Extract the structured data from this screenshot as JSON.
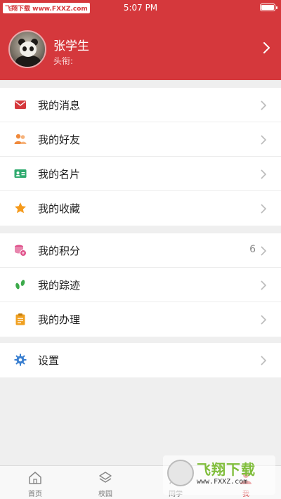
{
  "status_bar": {
    "watermark_text": "飞翔下载 www.FXXZ.com",
    "time": "5:07 PM"
  },
  "profile": {
    "name": "张学生",
    "title": "头衔:"
  },
  "groups": [
    {
      "items": [
        {
          "label": "我的消息",
          "icon": "mail-icon",
          "color": "#d5383c"
        },
        {
          "label": "我的好友",
          "icon": "friends-icon",
          "color": "#f08a3c"
        },
        {
          "label": "我的名片",
          "icon": "business-card-icon",
          "color": "#2eaa6e"
        },
        {
          "label": "我的收藏",
          "icon": "star-icon",
          "color": "#f59a1b"
        }
      ]
    },
    {
      "items": [
        {
          "label": "我的积分",
          "icon": "points-icon",
          "color": "#e0508a",
          "value": "6"
        },
        {
          "label": "我的踪迹",
          "icon": "footprints-icon",
          "color": "#3caa4a"
        },
        {
          "label": "我的办理",
          "icon": "clipboard-icon",
          "color": "#f0a020"
        }
      ]
    },
    {
      "items": [
        {
          "label": "设置",
          "icon": "gear-icon",
          "color": "#3a7fd0"
        }
      ]
    }
  ],
  "tabs": [
    {
      "label": "首页",
      "icon": "home-icon"
    },
    {
      "label": "校园",
      "icon": "layers-icon"
    },
    {
      "label": "同学",
      "icon": "classmates-icon"
    },
    {
      "label": "我",
      "icon": "me-icon",
      "active": true
    }
  ],
  "overlay_watermark": {
    "title": "飞翔下载",
    "url": "www.FXXZ.com"
  },
  "colors": {
    "brand_red": "#d5383c"
  }
}
